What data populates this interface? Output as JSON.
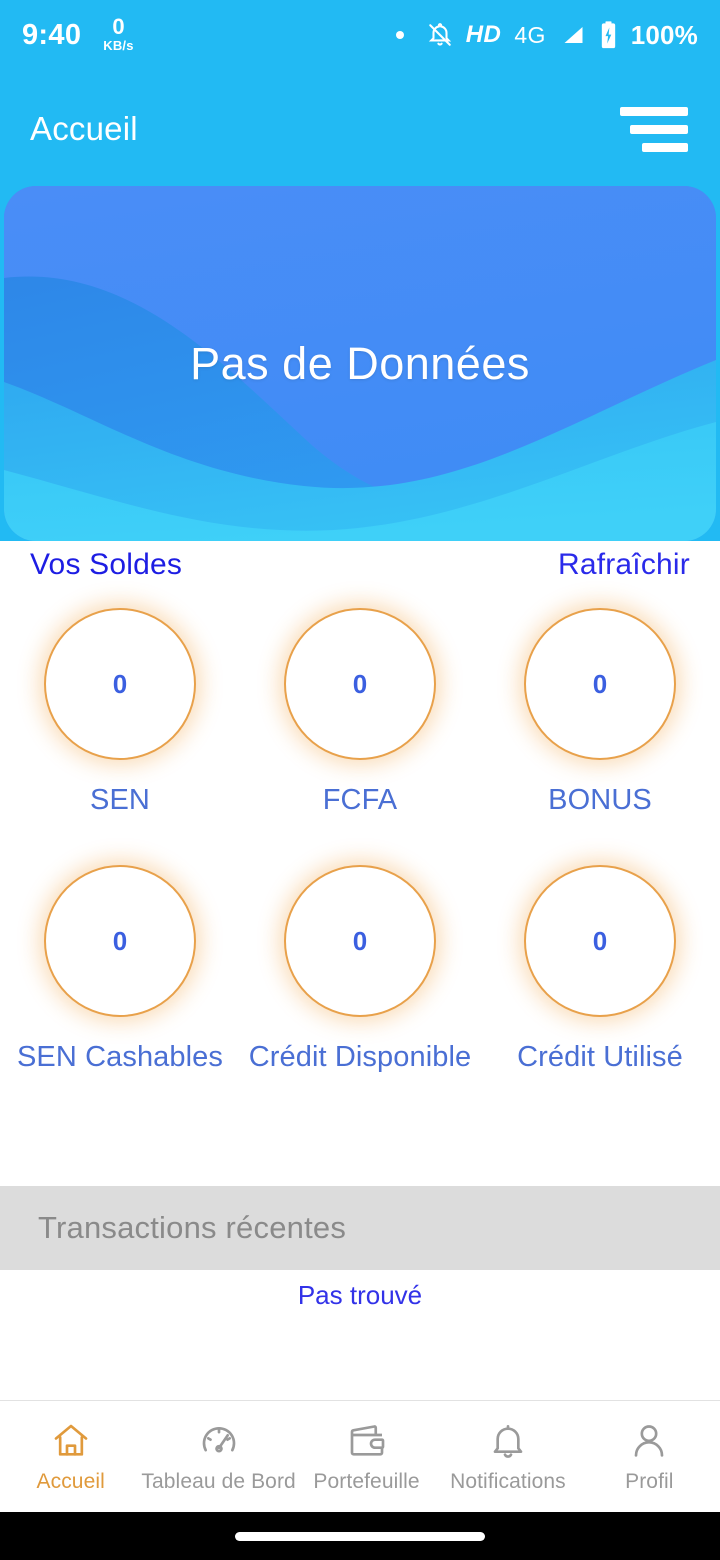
{
  "statusbar": {
    "time": "9:40",
    "network_speed_value": "0",
    "network_speed_unit": "KB/s",
    "hd_label": "HD",
    "network_type": "4G",
    "battery_percent": "100%",
    "icons": [
      "dot-icon",
      "bell-muted-icon",
      "signal-icon",
      "battery-charging-icon"
    ]
  },
  "appbar": {
    "title": "Accueil",
    "menu_icon": "hamburger-menu-icon"
  },
  "banner": {
    "text": "Pas de Données"
  },
  "balances_section": {
    "title": "Vos Soldes",
    "refresh_label": "Rafraîchir",
    "rows": [
      [
        {
          "value": "0",
          "label": "SEN"
        },
        {
          "value": "0",
          "label": "FCFA"
        },
        {
          "value": "0",
          "label": "BONUS"
        }
      ],
      [
        {
          "value": "0",
          "label": "SEN Cashables"
        },
        {
          "value": "0",
          "label": "Crédit Disponible"
        },
        {
          "value": "0",
          "label": "Crédit Utilisé"
        }
      ]
    ]
  },
  "transactions": {
    "header": "Transactions récentes",
    "empty_text": "Pas trouvé"
  },
  "bottom_nav": {
    "items": [
      {
        "label": "Accueil",
        "icon": "home-icon",
        "active": true
      },
      {
        "label": "Tableau de Bord",
        "icon": "speedometer-icon",
        "active": false
      },
      {
        "label": "Portefeuille",
        "icon": "wallet-icon",
        "active": false
      },
      {
        "label": "Notifications",
        "icon": "bell-icon",
        "active": false
      },
      {
        "label": "Profil",
        "icon": "person-icon",
        "active": false
      }
    ]
  },
  "colors": {
    "brand_cyan": "#22baf3",
    "accent_orange": "#e09a3c",
    "link_blue": "#2a2aea",
    "label_blue": "#4a6fd4",
    "value_blue": "#3b5fe0",
    "tx_bar_gray": "#dcdcdc"
  }
}
